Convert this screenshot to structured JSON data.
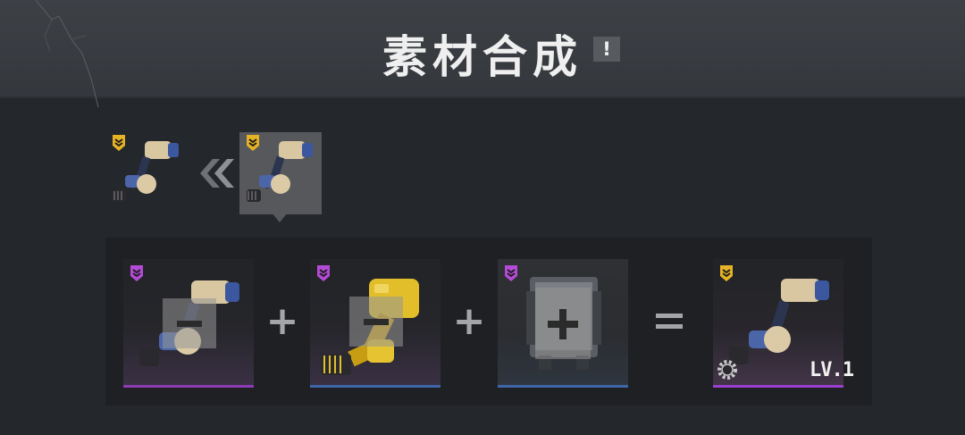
{
  "header": {
    "title": "素材合成",
    "info_icon_glyph": "!"
  },
  "preview": {
    "from_item": {
      "icon": "mech-arm-icon",
      "rank_color": "#e6b326"
    },
    "to_item": {
      "icon": "mech-arm-icon",
      "rank_color": "#e6b326",
      "selected": true
    },
    "direction_icon": "double-chevron-left-icon"
  },
  "recipe": {
    "inputs": [
      {
        "icon": "mech-arm-icon",
        "rank_color": "#b34bd6",
        "bar_color": "#8c3bb5",
        "overlay": "minus-icon"
      },
      {
        "icon": "yellow-mech-arm-icon",
        "rank_color": "#b34bd6",
        "bar_color": "#3f66a8",
        "overlay": "minus-icon"
      },
      {
        "icon": "mech-chest-icon",
        "rank_color": "#b34bd6",
        "bar_color": "#3f66a8",
        "overlay": "plus-icon"
      }
    ],
    "operators": [
      "+",
      "+",
      "="
    ],
    "result": {
      "icon": "mech-arm-icon",
      "rank_color": "#e6b326",
      "bar_color": "#9a3fd0",
      "level_label": "LV.1",
      "corner_icon": "gear-icon"
    }
  }
}
